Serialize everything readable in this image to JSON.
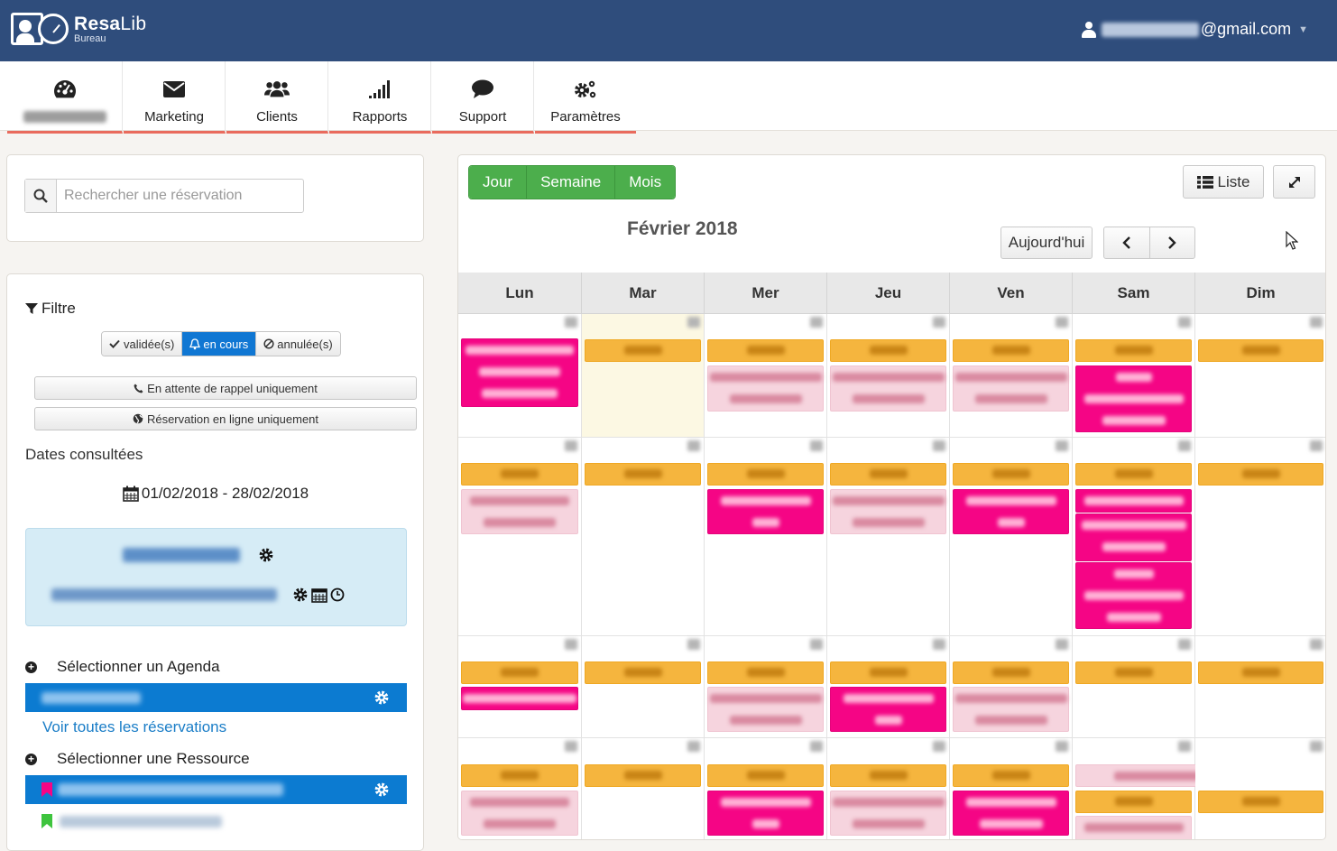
{
  "app": {
    "name_bold": "Resa",
    "name_light": "Lib",
    "subtitle": "Bureau"
  },
  "user": {
    "email_suffix": "@gmail.com"
  },
  "nav": {
    "tabs": [
      {
        "label": "",
        "icon": "dashboard-icon"
      },
      {
        "label": "Marketing",
        "icon": "envelope-icon"
      },
      {
        "label": "Clients",
        "icon": "users-icon"
      },
      {
        "label": "Rapports",
        "icon": "signal-icon"
      },
      {
        "label": "Support",
        "icon": "chat-icon"
      },
      {
        "label": "Paramètres",
        "icon": "gears-icon"
      }
    ],
    "accent_color": "#e96b5d"
  },
  "search": {
    "placeholder": "Rechercher une réservation"
  },
  "filter": {
    "title": "Filtre",
    "status_buttons": [
      {
        "label": "validée(s)",
        "active": false
      },
      {
        "label": "en cours",
        "active": true
      },
      {
        "label": "annulée(s)",
        "active": false
      }
    ],
    "callback_only": "En attente de rappel uniquement",
    "online_only": "Réservation en ligne uniquement",
    "dates_title": "Dates consultées",
    "dates_range": "01/02/2018 - 28/02/2018"
  },
  "sidebar": {
    "select_agenda": "Sélectionner un Agenda",
    "see_all": "Voir toutes les réservations",
    "select_resource": "Sélectionner une Ressource"
  },
  "calendar": {
    "views": [
      "Jour",
      "Semaine",
      "Mois"
    ],
    "list_label": "Liste",
    "month_title": "Février 2018",
    "today_label": "Aujourd'hui",
    "days": [
      "Lun",
      "Mar",
      "Mer",
      "Jeu",
      "Ven",
      "Sam",
      "Dim"
    ],
    "colors": {
      "add": "#f5b53e",
      "pending": "#f50585",
      "validated": "#f6d4de",
      "view_buttons": "#4cae4c",
      "primary": "#0c7bd1"
    }
  }
}
